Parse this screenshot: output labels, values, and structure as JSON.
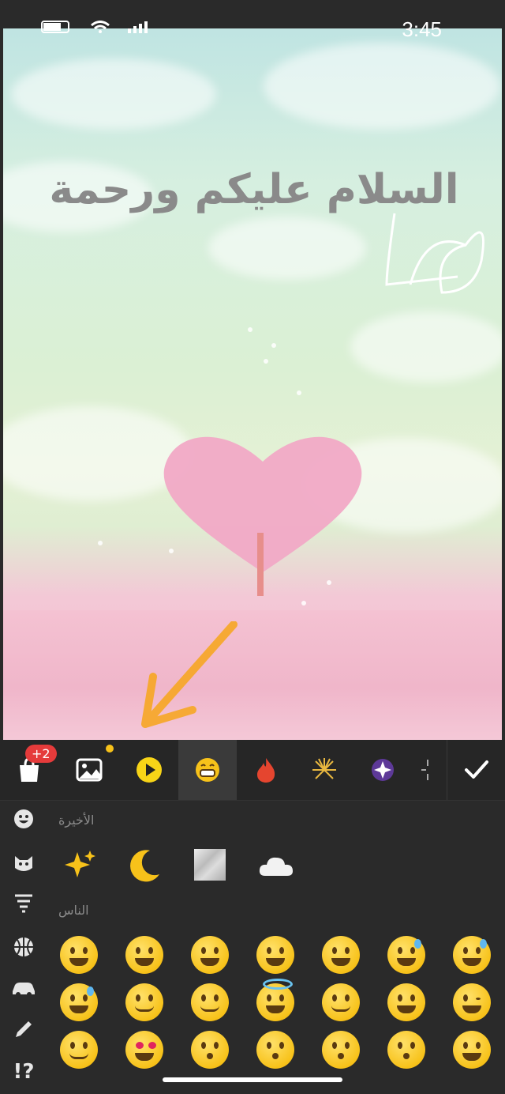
{
  "status": {
    "time": "3:45"
  },
  "canvas": {
    "greeting_text": "السلام عليكم ورحمة"
  },
  "toolbar": {
    "badge": "+2",
    "tools": [
      "shop-icon",
      "image-icon",
      "play-icon",
      "emoji-icon",
      "flame-icon",
      "firework-icon",
      "sparkle-sticker-icon",
      "more-icon"
    ],
    "active_tool": "emoji-icon",
    "confirm_icon": "check-icon"
  },
  "emoji_panel": {
    "categories": [
      "smiley-icon",
      "cat-icon",
      "tornado-icon",
      "basketball-icon",
      "car-icon",
      "pencil-icon",
      "symbols-icon"
    ],
    "symbols_label": "!?",
    "recent_label": "الأخيرة",
    "recent": [
      "sparkles",
      "crescent-moon",
      "marble-square",
      "cloud"
    ],
    "people_label": "الناس",
    "people_rows": [
      [
        "grinning",
        "smiley",
        "smile",
        "grin",
        "laughing",
        "sweat-smile",
        "joy"
      ],
      [
        "rofl",
        "relaxed",
        "blush",
        "innocent",
        "slight-smile",
        "upside-down",
        "wink"
      ],
      [
        "relieved",
        "heart-eyes",
        "kissing-heart",
        "kissing",
        "kissing-smiling",
        "kissing-closed-eyes",
        "yum"
      ]
    ]
  },
  "colors": {
    "accent_yellow": "#f7c21a",
    "panel_bg": "#2a2a2a",
    "badge_red": "#e53b3b"
  }
}
